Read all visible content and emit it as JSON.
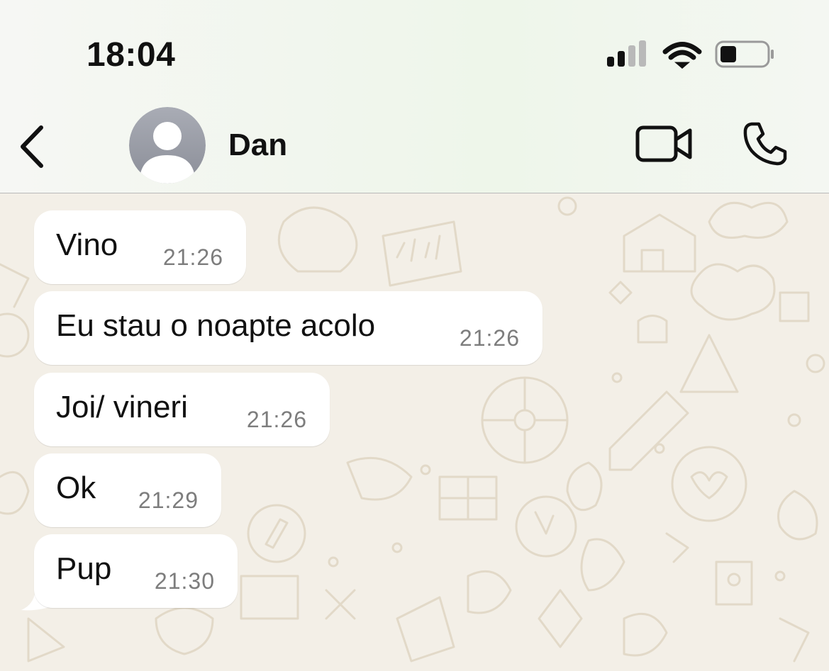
{
  "status_bar": {
    "time": "18:04"
  },
  "header": {
    "contact_name": "Dan"
  },
  "messages": [
    {
      "text": "Vino",
      "time": "21:26"
    },
    {
      "text": "Eu stau o noapte acolo",
      "time": "21:26"
    },
    {
      "text": "Joi/ vineri",
      "time": "21:26"
    },
    {
      "text": "Ok",
      "time": "21:29"
    },
    {
      "text": "Pup",
      "time": "21:30"
    }
  ],
  "icons": {
    "back": "chevron-left-icon",
    "avatar": "person-icon",
    "video": "video-camera-icon",
    "call": "phone-icon",
    "signal": "cellular-signal-icon",
    "wifi": "wifi-icon",
    "battery": "battery-icon"
  },
  "colors": {
    "chat_background": "#f3efe7",
    "bubble": "#ffffff",
    "timestamp": "#7d7d7d"
  }
}
